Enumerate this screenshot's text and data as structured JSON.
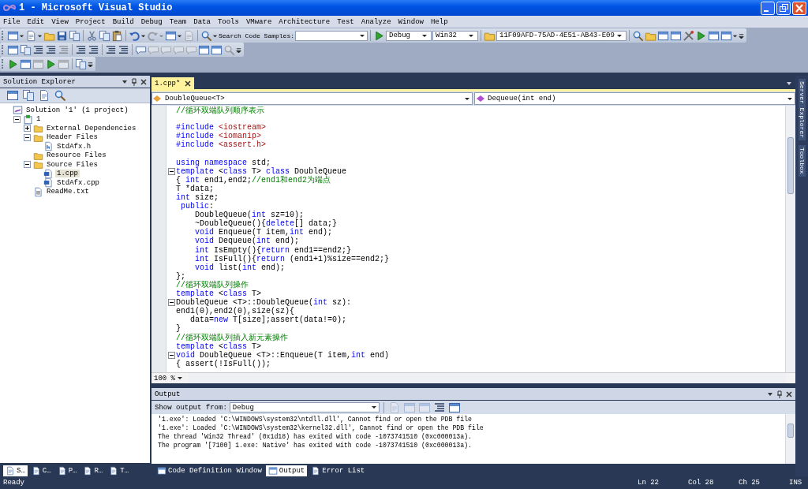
{
  "window": {
    "title": "1 - Microsoft Visual Studio"
  },
  "menu": [
    "File",
    "Edit",
    "View",
    "Project",
    "Build",
    "Debug",
    "Team",
    "Data",
    "Tools",
    "VMware",
    "Architecture",
    "Test",
    "Analyze",
    "Window",
    "Help"
  ],
  "toolbars": [
    [
      {
        "kind": "window",
        "dropdown": true,
        "disabled": false
      },
      {
        "kind": "page",
        "dropdown": true,
        "disabled": false
      },
      {
        "kind": "folder",
        "disabled": false
      },
      {
        "kind": "save",
        "disabled": false
      },
      {
        "kind": "copy",
        "disabled": false
      },
      {
        "kind": "sep"
      },
      {
        "kind": "cut",
        "disabled": false
      },
      {
        "kind": "copy",
        "disabled": false
      },
      {
        "kind": "paste",
        "disabled": false
      },
      {
        "kind": "sep"
      },
      {
        "kind": "undo",
        "dropdown": true,
        "disabled": false
      },
      {
        "kind": "redo",
        "dropdown": true,
        "disabled": true
      },
      {
        "kind": "window",
        "dropdown": true,
        "disabled": false
      },
      {
        "kind": "page",
        "disabled": true
      },
      {
        "kind": "sep"
      },
      {
        "kind": "search",
        "dropdown": true,
        "disabled": false
      },
      {
        "kind": "label",
        "text": "Search Code Samples:",
        "disabled": false
      },
      {
        "kind": "field",
        "disabled": false
      },
      {
        "kind": "sep"
      },
      {
        "kind": "play",
        "disabled": false
      },
      {
        "kind": "combo",
        "text": "Debug",
        "disabled": false
      },
      {
        "kind": "combo",
        "text": "Win32",
        "disabled": false
      },
      {
        "kind": "sep"
      },
      {
        "kind": "folder",
        "disabled": false
      },
      {
        "kind": "combo",
        "text": "11F09AFD-75AD-4E51-AB43-E09",
        "disabled": false
      },
      {
        "kind": "sep"
      },
      {
        "kind": "search",
        "disabled": false
      },
      {
        "kind": "folder",
        "disabled": false
      },
      {
        "kind": "window",
        "disabled": false
      },
      {
        "kind": "window",
        "disabled": false
      },
      {
        "kind": "tools",
        "disabled": false
      },
      {
        "kind": "play",
        "disabled": false
      },
      {
        "kind": "window",
        "disabled": false
      },
      {
        "kind": "window",
        "dropdown": true,
        "disabled": false
      },
      {
        "kind": "overflow",
        "disabled": false
      }
    ],
    [
      {
        "kind": "window",
        "disabled": false
      },
      {
        "kind": "copy",
        "disabled": false
      },
      {
        "kind": "lines",
        "disabled": false
      },
      {
        "kind": "lines",
        "disabled": false
      },
      {
        "kind": "lines",
        "disabled": true
      },
      {
        "kind": "sep"
      },
      {
        "kind": "lines",
        "disabled": false
      },
      {
        "kind": "lines",
        "disabled": false
      },
      {
        "kind": "sep"
      },
      {
        "kind": "lines",
        "disabled": false
      },
      {
        "kind": "lines",
        "disabled": false
      },
      {
        "kind": "sep"
      },
      {
        "kind": "bubble",
        "disabled": false
      },
      {
        "kind": "bubble",
        "disabled": true
      },
      {
        "kind": "bubble",
        "disabled": true
      },
      {
        "kind": "bubble",
        "disabled": true
      },
      {
        "kind": "bubble",
        "disabled": true
      },
      {
        "kind": "window",
        "disabled": false
      },
      {
        "kind": "window",
        "disabled": false
      },
      {
        "kind": "search",
        "disabled": true
      },
      {
        "kind": "overflow",
        "disabled": false
      }
    ],
    [
      {
        "kind": "play",
        "disabled": false
      },
      {
        "kind": "window",
        "disabled": false
      },
      {
        "kind": "window",
        "disabled": true
      },
      {
        "kind": "play",
        "disabled": false
      },
      {
        "kind": "window",
        "disabled": true
      },
      {
        "kind": "sep"
      },
      {
        "kind": "copy",
        "disabled": false
      },
      {
        "kind": "overflow",
        "disabled": false
      }
    ]
  ],
  "solution_explorer": {
    "title": "Solution Explorer",
    "toolbar": [
      {
        "kind": "window",
        "disabled": false
      },
      {
        "kind": "copy",
        "disabled": false
      },
      {
        "kind": "page",
        "disabled": false
      },
      {
        "kind": "search",
        "disabled": false
      }
    ],
    "tree": [
      {
        "label": "Solution '1' (1 project)",
        "kind": "solution",
        "selected": false,
        "children": [
          {
            "label": "1",
            "kind": "project",
            "selected": false,
            "expanded": true,
            "children": [
              {
                "label": "External Dependencies",
                "kind": "folder",
                "selected": false,
                "expanded": false
              },
              {
                "label": "Header Files",
                "kind": "folder",
                "selected": false,
                "expanded": true,
                "children": [
                  {
                    "label": "StdAfx.h",
                    "kind": "header",
                    "selected": false
                  }
                ]
              },
              {
                "label": "Resource Files",
                "kind": "folder",
                "selected": false
              },
              {
                "label": "Source Files",
                "kind": "folder",
                "selected": false,
                "expanded": true,
                "children": [
                  {
                    "label": "1.cpp",
                    "kind": "cpp",
                    "selected": true
                  },
                  {
                    "label": "StdAfx.cpp",
                    "kind": "cpp",
                    "selected": false
                  }
                ]
              },
              {
                "label": "ReadMe.txt",
                "kind": "txt",
                "selected": false
              }
            ]
          }
        ]
      }
    ],
    "tabs": [
      {
        "label": "S…",
        "selected": true
      },
      {
        "label": "C…",
        "selected": false
      },
      {
        "label": "P…",
        "selected": false
      },
      {
        "label": "R…",
        "selected": false
      },
      {
        "label": "T…",
        "selected": false
      }
    ]
  },
  "editor": {
    "tabs": [
      {
        "label": "1.cpp*",
        "selected": true
      }
    ],
    "type_combo": "DoubleQueue<T>",
    "member_combo": "Dequeue(int end)",
    "lines": [
      {
        "fold": false,
        "parts": [
          {
            "kind": "comment",
            "s": "//循环双端队列顺序表示"
          }
        ]
      },
      {
        "fold": false
      },
      {
        "fold": false,
        "parts": [
          {
            "kind": "keyword",
            "s": "#include "
          },
          {
            "kind": "string",
            "s": "<iostream>"
          }
        ]
      },
      {
        "fold": false,
        "parts": [
          {
            "kind": "keyword",
            "s": "#include "
          },
          {
            "kind": "string",
            "s": "<iomanip>"
          }
        ]
      },
      {
        "fold": false,
        "parts": [
          {
            "kind": "keyword",
            "s": "#include "
          },
          {
            "kind": "string",
            "s": "<assert.h>"
          }
        ]
      },
      {
        "fold": false
      },
      {
        "fold": false,
        "parts": [
          {
            "kind": "keyword",
            "s": "using namespace"
          },
          {
            "kind": "plain",
            "s": " std;"
          }
        ]
      },
      {
        "fold": true,
        "parts": [
          {
            "kind": "keyword",
            "s": "template"
          },
          {
            "kind": "plain",
            "s": " <"
          },
          {
            "kind": "keyword",
            "s": "class"
          },
          {
            "kind": "plain",
            "s": " T> "
          },
          {
            "kind": "keyword",
            "s": "class"
          },
          {
            "kind": "plain",
            "s": " DoubleQueue"
          }
        ]
      },
      {
        "fold": false,
        "parts": [
          {
            "kind": "plain",
            "s": "{ "
          },
          {
            "kind": "keyword",
            "s": "int"
          },
          {
            "kind": "plain",
            "s": " end1,end2;"
          },
          {
            "kind": "comment",
            "s": "//end1和end2为端点"
          }
        ]
      },
      {
        "fold": false,
        "parts": [
          {
            "kind": "plain",
            "s": "T *data;"
          }
        ]
      },
      {
        "fold": false,
        "parts": [
          {
            "kind": "keyword",
            "s": "int"
          },
          {
            "kind": "plain",
            "s": " size;"
          }
        ]
      },
      {
        "fold": false,
        "parts": [
          {
            "kind": "keyword",
            "s": " public"
          },
          {
            "kind": "plain",
            "s": ":"
          }
        ]
      },
      {
        "fold": false,
        "parts": [
          {
            "kind": "plain",
            "s": "    DoubleQueue("
          },
          {
            "kind": "keyword",
            "s": "int"
          },
          {
            "kind": "plain",
            "s": " sz=10);"
          }
        ]
      },
      {
        "fold": false,
        "parts": [
          {
            "kind": "plain",
            "s": "    ~DoubleQueue(){"
          },
          {
            "kind": "keyword",
            "s": "delete"
          },
          {
            "kind": "plain",
            "s": "[] data;}"
          }
        ]
      },
      {
        "fold": false,
        "parts": [
          {
            "kind": "keyword",
            "s": "    void"
          },
          {
            "kind": "plain",
            "s": " Enqueue(T item,"
          },
          {
            "kind": "keyword",
            "s": "int"
          },
          {
            "kind": "plain",
            "s": " end);"
          }
        ]
      },
      {
        "fold": false,
        "parts": [
          {
            "kind": "keyword",
            "s": "    void"
          },
          {
            "kind": "plain",
            "s": " Dequeue("
          },
          {
            "kind": "keyword",
            "s": "int"
          },
          {
            "kind": "plain",
            "s": " end);"
          }
        ]
      },
      {
        "fold": false,
        "parts": [
          {
            "kind": "keyword",
            "s": "    int"
          },
          {
            "kind": "plain",
            "s": " IsEmpty(){"
          },
          {
            "kind": "keyword",
            "s": "return"
          },
          {
            "kind": "plain",
            "s": " end1==end2;}"
          }
        ]
      },
      {
        "fold": false,
        "parts": [
          {
            "kind": "keyword",
            "s": "    int"
          },
          {
            "kind": "plain",
            "s": " IsFull(){"
          },
          {
            "kind": "keyword",
            "s": "return"
          },
          {
            "kind": "plain",
            "s": " (end1+1)%size==end2;}"
          }
        ]
      },
      {
        "fold": false,
        "parts": [
          {
            "kind": "keyword",
            "s": "    void"
          },
          {
            "kind": "plain",
            "s": " list("
          },
          {
            "kind": "keyword",
            "s": "int"
          },
          {
            "kind": "plain",
            "s": " end);"
          }
        ]
      },
      {
        "fold": false,
        "parts": [
          {
            "kind": "plain",
            "s": "};"
          }
        ]
      },
      {
        "fold": false,
        "parts": [
          {
            "kind": "comment",
            "s": "//循环双端队列操作"
          }
        ]
      },
      {
        "fold": false,
        "parts": [
          {
            "kind": "keyword",
            "s": "template"
          },
          {
            "kind": "plain",
            "s": " <"
          },
          {
            "kind": "keyword",
            "s": "class"
          },
          {
            "kind": "plain",
            "s": " T>"
          }
        ]
      },
      {
        "fold": true,
        "parts": [
          {
            "kind": "plain",
            "s": "DoubleQueue <T>::DoubleQueue("
          },
          {
            "kind": "keyword",
            "s": "int"
          },
          {
            "kind": "plain",
            "s": " sz):"
          }
        ]
      },
      {
        "fold": false,
        "parts": [
          {
            "kind": "plain",
            "s": "end1(0),end2(0),size(sz){"
          }
        ]
      },
      {
        "fold": false,
        "parts": [
          {
            "kind": "plain",
            "s": "   data="
          },
          {
            "kind": "keyword",
            "s": "new"
          },
          {
            "kind": "plain",
            "s": " T[size];assert(data!=0);"
          }
        ]
      },
      {
        "fold": false,
        "parts": [
          {
            "kind": "plain",
            "s": "}"
          }
        ]
      },
      {
        "fold": false,
        "parts": [
          {
            "kind": "comment",
            "s": "//循环双端队列插入新元素操作"
          }
        ]
      },
      {
        "fold": false,
        "parts": [
          {
            "kind": "keyword",
            "s": "template"
          },
          {
            "kind": "plain",
            "s": " <"
          },
          {
            "kind": "keyword",
            "s": "class"
          },
          {
            "kind": "plain",
            "s": " T>"
          }
        ]
      },
      {
        "fold": true,
        "parts": [
          {
            "kind": "keyword",
            "s": "void"
          },
          {
            "kind": "plain",
            "s": " DoubleQueue <T>::Enqueue(T item,"
          },
          {
            "kind": "keyword",
            "s": "int"
          },
          {
            "kind": "plain",
            "s": " end)"
          }
        ]
      },
      {
        "fold": false,
        "parts": [
          {
            "kind": "plain",
            "s": "{ assert(!IsFull());"
          }
        ]
      }
    ],
    "zoom": "100 %"
  },
  "output": {
    "title": "Output",
    "source_label": "Show output from:",
    "source": "Debug",
    "toolbar": [
      {
        "kind": "page",
        "disabled": true
      },
      {
        "kind": "window",
        "disabled": true
      },
      {
        "kind": "window",
        "disabled": true
      },
      {
        "kind": "lines",
        "disabled": false
      },
      {
        "kind": "window",
        "disabled": false
      }
    ],
    "lines": [
      "'1.exe': Loaded 'C:\\WINDOWS\\system32\\ntdll.dll', Cannot find or open the PDB file",
      "'1.exe': Loaded 'C:\\WINDOWS\\system32\\kernel32.dll', Cannot find or open the PDB file",
      "The thread 'Win32 Thread' (0x1d18) has exited with code -1073741510 (0xc000013a).",
      "The program '[7100] 1.exe: Native' has exited with code -1073741510 (0xc000013a)."
    ]
  },
  "bottom_tabs": [
    {
      "label": "Code Definition Window",
      "kind": "window",
      "selected": false
    },
    {
      "label": "Output",
      "kind": "window",
      "selected": true
    },
    {
      "label": "Error List",
      "kind": "page",
      "selected": false
    }
  ],
  "side_tabs": [
    "Server Explorer",
    "Toolbox"
  ],
  "status_bar": {
    "message": "Ready",
    "line": "Ln 22",
    "column": "Col 28",
    "char": "Ch 25",
    "mode": "INS"
  }
}
